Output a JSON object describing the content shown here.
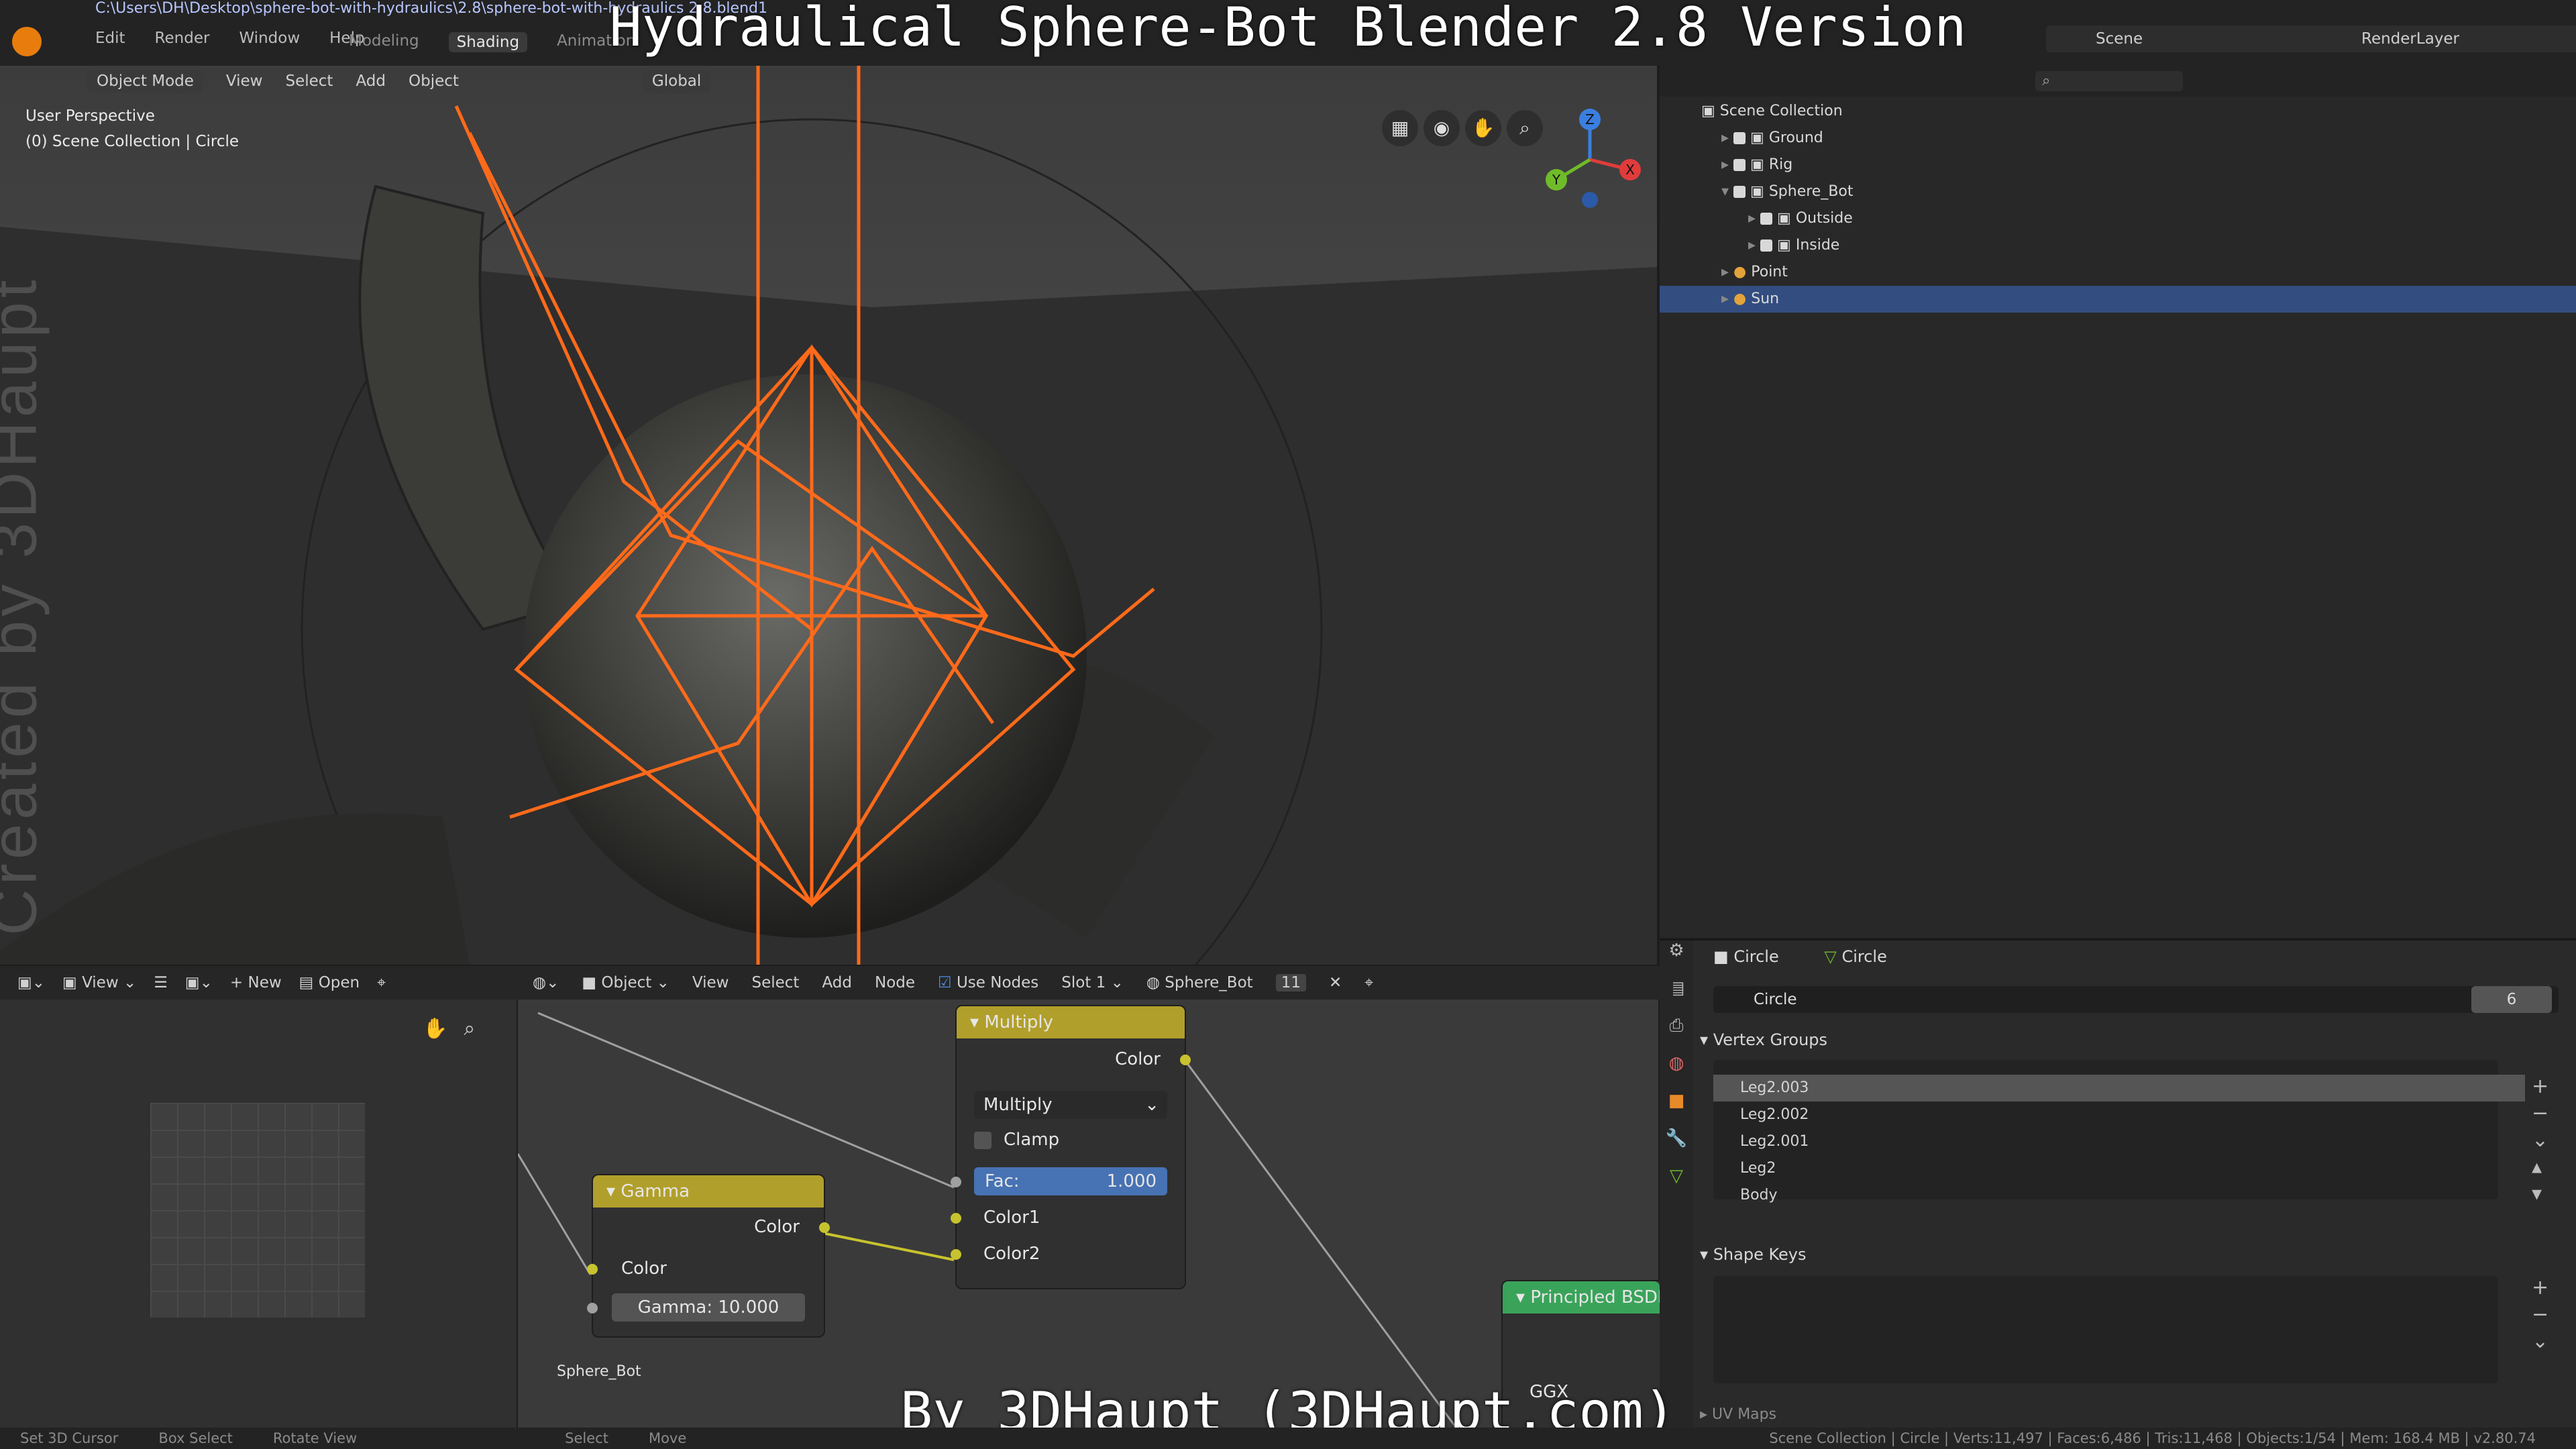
{
  "title_overlay": "Hydraulical Sphere-Bot Blender 2.8 Version",
  "credit_overlay": "By 3DHaupt (3DHaupt.com)",
  "watermark": "Created by 3DHaupt",
  "file_path": "C:\\Users\\DH\\Desktop\\sphere-bot-with-hydraulics\\2.8\\sphere-bot-with-hydraulics 2.8.blend1",
  "menu": [
    "Edit",
    "Render",
    "Window",
    "Help"
  ],
  "workspaces": [
    "Modeling",
    "Shading",
    "Animation"
  ],
  "active_workspace": "Shading",
  "scene_name": "Scene",
  "render_layer": "RenderLayer",
  "viewport": {
    "mode": "Object Mode",
    "menu": [
      "View",
      "Select",
      "Add",
      "Object"
    ],
    "orientation": "Global",
    "perspective": "User Perspective",
    "collection_info": "(0) Scene Collection | Circle",
    "axes": [
      "Z",
      "Y",
      "X"
    ],
    "accent": "#ff6a1a"
  },
  "outliner": {
    "rows": [
      {
        "label": "Scene Collection",
        "selected": false
      },
      {
        "label": "Ground",
        "selected": false
      },
      {
        "label": "Rig",
        "selected": false
      },
      {
        "label": "Sphere_Bot",
        "selected": false
      },
      {
        "label": "Outside",
        "selected": false
      },
      {
        "label": "Inside",
        "selected": false
      },
      {
        "label": "Point",
        "selected": false
      },
      {
        "label": "Sun",
        "selected": true
      }
    ]
  },
  "properties": {
    "breadcrumb_obj": "Circle",
    "breadcrumb_data": "Circle",
    "data_name": "Circle",
    "users": "6",
    "vertex_groups_title": "Vertex Groups",
    "vertex_groups": [
      "Leg2.003",
      "Leg2.002",
      "Leg2.001",
      "Leg2",
      "Body"
    ],
    "shape_keys_title": "Shape Keys",
    "uv_maps_title": "UV Maps"
  },
  "image_editor": {
    "view": "View",
    "new": "New",
    "open": "Open"
  },
  "node_editor": {
    "header": {
      "object": "Object",
      "menu": [
        "View",
        "Select",
        "Add",
        "Node"
      ],
      "use_nodes": "Use Nodes",
      "slot": "Slot 1",
      "material": "Sphere_Bot",
      "users": "11"
    },
    "material_label": "Sphere_Bot",
    "gamma_node": {
      "title": "Gamma",
      "out_color": "Color",
      "in_color": "Color",
      "gamma_label": "Gamma:",
      "gamma_value": "10.000"
    },
    "multiply_node": {
      "title": "Multiply",
      "out_color": "Color",
      "blend": "Multiply",
      "clamp": "Clamp",
      "fac_label": "Fac:",
      "fac_value": "1.000",
      "color1": "Color1",
      "color2": "Color2"
    },
    "bsdf_node": {
      "title": "Principled BSDF",
      "distribution": "GGX"
    }
  },
  "status": {
    "left": [
      "Set 3D Cursor",
      "Box Select",
      "Rotate View",
      "Select",
      "Move"
    ],
    "right": "Scene Collection | Circle | Verts:11,497 | Faces:6,486 | Tris:11,468 | Objects:1/54 | Mem: 168.4 MB | v2.80.74"
  }
}
